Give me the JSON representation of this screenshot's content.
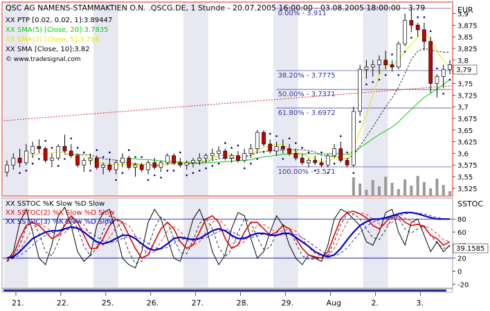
{
  "chart_data": [
    {
      "type": "candlestick",
      "title": "QSC AG NAMENS-STAMMAKTIEN O.N. .QSCG.DE, 1 Stunde - 20.07.2005 16:00:00 - 03.08.2005 18:00:00 - 3.79",
      "currency": "EUR",
      "last_value": "3,79",
      "watermark": "© www.tradesignal.com",
      "legend": [
        {
          "label": "XX PTP [0.02, 0.02, 1]:3.89447",
          "color": "#000000"
        },
        {
          "label": "XX SMA(5) [Close, 20]:3.7835",
          "color": "#00cc00"
        },
        {
          "label": "XX SMA(2) [Close, 5]:3.786",
          "color": "#e6e600"
        },
        {
          "label": "XX SMA [Close, 10]:3.82",
          "color": "#000000"
        }
      ],
      "ylim": [
        3.51,
        3.92
      ],
      "y_ticks": [
        "3,525",
        "3,55",
        "3,575",
        "3,6",
        "3,625",
        "3,65",
        "3,675",
        "3,7",
        "3,725",
        "3,75",
        "3,775",
        "3,8",
        "3,825",
        "3,85",
        "3,875",
        "3,9"
      ],
      "fibonacci": [
        {
          "label": "0.00% - 3.911",
          "value": 3.911
        },
        {
          "label": "38.20% - 3.7775",
          "value": 3.7775
        },
        {
          "label": "50.00% - 3.7371",
          "value": 3.7371
        },
        {
          "label": "61.80% - 3.6972",
          "value": 3.6972
        },
        {
          "label": "100.00% - 3.571",
          "value": 3.571
        }
      ],
      "candles": [
        [
          3.56,
          3.585,
          3.55,
          3.575
        ],
        [
          3.575,
          3.6,
          3.565,
          3.59
        ],
        [
          3.59,
          3.61,
          3.57,
          3.58
        ],
        [
          3.58,
          3.62,
          3.575,
          3.605
        ],
        [
          3.6,
          3.625,
          3.59,
          3.615
        ],
        [
          3.615,
          3.63,
          3.6,
          3.61
        ],
        [
          3.61,
          3.615,
          3.58,
          3.585
        ],
        [
          3.585,
          3.6,
          3.57,
          3.59
        ],
        [
          3.59,
          3.62,
          3.585,
          3.615
        ],
        [
          3.615,
          3.64,
          3.6,
          3.605
        ],
        [
          3.605,
          3.62,
          3.59,
          3.595
        ],
        [
          3.595,
          3.6,
          3.57,
          3.575
        ],
        [
          3.575,
          3.59,
          3.56,
          3.585
        ],
        [
          3.585,
          3.6,
          3.575,
          3.59
        ],
        [
          3.59,
          3.595,
          3.565,
          3.57
        ],
        [
          3.57,
          3.58,
          3.555,
          3.575
        ],
        [
          3.575,
          3.59,
          3.56,
          3.565
        ],
        [
          3.565,
          3.585,
          3.555,
          3.58
        ],
        [
          3.58,
          3.6,
          3.57,
          3.59
        ],
        [
          3.59,
          3.595,
          3.565,
          3.57
        ],
        [
          3.57,
          3.58,
          3.55,
          3.575
        ],
        [
          3.575,
          3.58,
          3.56,
          3.565
        ],
        [
          3.565,
          3.585,
          3.555,
          3.58
        ],
        [
          3.58,
          3.59,
          3.565,
          3.57
        ],
        [
          3.57,
          3.585,
          3.56,
          3.58
        ],
        [
          3.58,
          3.6,
          3.575,
          3.595
        ],
        [
          3.595,
          3.6,
          3.575,
          3.58
        ],
        [
          3.58,
          3.59,
          3.57,
          3.575
        ],
        [
          3.575,
          3.585,
          3.565,
          3.58
        ],
        [
          3.58,
          3.59,
          3.57,
          3.585
        ],
        [
          3.585,
          3.6,
          3.575,
          3.59
        ],
        [
          3.59,
          3.6,
          3.58,
          3.595
        ],
        [
          3.595,
          3.61,
          3.585,
          3.6
        ],
        [
          3.6,
          3.615,
          3.59,
          3.605
        ],
        [
          3.605,
          3.61,
          3.585,
          3.59
        ],
        [
          3.59,
          3.6,
          3.58,
          3.595
        ],
        [
          3.595,
          3.605,
          3.58,
          3.585
        ],
        [
          3.585,
          3.61,
          3.58,
          3.6
        ],
        [
          3.6,
          3.62,
          3.59,
          3.61
        ],
        [
          3.61,
          3.65,
          3.6,
          3.645
        ],
        [
          3.645,
          3.65,
          3.615,
          3.62
        ],
        [
          3.62,
          3.63,
          3.6,
          3.605
        ],
        [
          3.605,
          3.625,
          3.595,
          3.615
        ],
        [
          3.615,
          3.63,
          3.6,
          3.61
        ],
        [
          3.61,
          3.62,
          3.595,
          3.6
        ],
        [
          3.6,
          3.61,
          3.585,
          3.59
        ],
        [
          3.59,
          3.6,
          3.575,
          3.58
        ],
        [
          3.58,
          3.59,
          3.57,
          3.585
        ],
        [
          3.585,
          3.595,
          3.575,
          3.58
        ],
        [
          3.58,
          3.59,
          3.57,
          3.575
        ],
        [
          3.575,
          3.6,
          3.57,
          3.595
        ],
        [
          3.595,
          3.62,
          3.59,
          3.61
        ],
        [
          3.61,
          3.625,
          3.58,
          3.585
        ],
        [
          3.585,
          3.59,
          3.57,
          3.575
        ],
        [
          3.575,
          3.7,
          3.57,
          3.69
        ],
        [
          3.69,
          3.79,
          3.68,
          3.78
        ],
        [
          3.78,
          3.8,
          3.76,
          3.785
        ],
        [
          3.785,
          3.8,
          3.765,
          3.79
        ],
        [
          3.79,
          3.81,
          3.77,
          3.8
        ],
        [
          3.8,
          3.82,
          3.78,
          3.79
        ],
        [
          3.79,
          3.8,
          3.775,
          3.785
        ],
        [
          3.785,
          3.84,
          3.78,
          3.835
        ],
        [
          3.835,
          3.9,
          3.83,
          3.885
        ],
        [
          3.885,
          3.91,
          3.86,
          3.875
        ],
        [
          3.875,
          3.88,
          3.85,
          3.865
        ],
        [
          3.865,
          3.88,
          3.82,
          3.84
        ],
        [
          3.84,
          3.85,
          3.73,
          3.75
        ],
        [
          3.75,
          3.77,
          3.72,
          3.765
        ],
        [
          3.765,
          3.79,
          3.74,
          3.78
        ],
        [
          3.78,
          3.8,
          3.77,
          3.79
        ]
      ],
      "x_ticks": [
        "21.",
        "22.",
        "25.",
        "26.",
        "27.",
        "28.",
        "29.",
        "Aug",
        "2.",
        "3."
      ]
    },
    {
      "type": "line",
      "title": "SSTOC",
      "legend": [
        {
          "label": "XX SSTOC %K Slow %D Slow",
          "color": "#000000"
        },
        {
          "label": "XX SSTOC(2) %K Slow %D Slow",
          "color": "#dd0000"
        },
        {
          "label": "XX SSTOC(3) %K Slow %D Slow",
          "color": "#0000cc"
        }
      ],
      "ylim": [
        -25,
        110
      ],
      "y_ticks": [
        "80",
        "60",
        "40",
        "20",
        "0",
        "-20"
      ],
      "last_value": "39.1585",
      "series": [
        {
          "name": "XX SSTOC %K Slow %D Slow",
          "values": [
            15,
            30,
            75,
            95,
            60,
            20,
            10,
            40,
            85,
            98,
            70,
            30,
            15,
            25,
            70,
            90,
            95,
            60,
            20,
            10,
            5,
            30,
            75,
            95,
            80,
            50,
            20,
            15,
            45,
            80,
            95,
            70,
            30,
            10,
            25,
            65,
            90,
            85,
            50,
            20,
            30,
            60,
            85,
            70,
            40,
            20,
            10,
            25,
            20,
            15,
            40,
            80,
            95,
            90,
            80,
            70,
            45,
            40,
            60,
            90,
            95,
            60,
            40,
            75,
            80,
            55,
            30,
            45,
            30,
            40
          ]
        },
        {
          "name": "XX SSTOC(2) %K Slow %D Slow",
          "values": [
            20,
            25,
            50,
            70,
            75,
            70,
            60,
            50,
            55,
            70,
            85,
            75,
            55,
            35,
            35,
            50,
            70,
            80,
            75,
            55,
            35,
            20,
            25,
            45,
            65,
            75,
            65,
            45,
            35,
            40,
            60,
            80,
            85,
            75,
            50,
            35,
            40,
            60,
            75,
            75,
            65,
            55,
            60,
            70,
            65,
            50,
            35,
            25,
            22,
            20,
            30,
            55,
            80,
            90,
            92,
            88,
            82,
            70,
            65,
            75,
            85,
            85,
            75,
            70,
            72,
            68,
            55,
            50,
            40,
            45
          ]
        },
        {
          "name": "XX SSTOC(3) %K Slow %D Slow",
          "values": [
            20,
            22,
            30,
            40,
            50,
            55,
            60,
            62,
            62,
            65,
            68,
            66,
            60,
            52,
            45,
            42,
            45,
            50,
            55,
            55,
            50,
            42,
            35,
            32,
            35,
            42,
            50,
            52,
            50,
            48,
            50,
            56,
            62,
            65,
            62,
            55,
            50,
            50,
            55,
            58,
            58,
            55,
            55,
            58,
            58,
            52,
            45,
            38,
            30,
            25,
            22,
            25,
            35,
            48,
            60,
            70,
            76,
            80,
            80,
            82,
            85,
            88,
            90,
            90,
            88,
            85,
            82,
            80,
            80,
            80
          ]
        }
      ]
    }
  ]
}
